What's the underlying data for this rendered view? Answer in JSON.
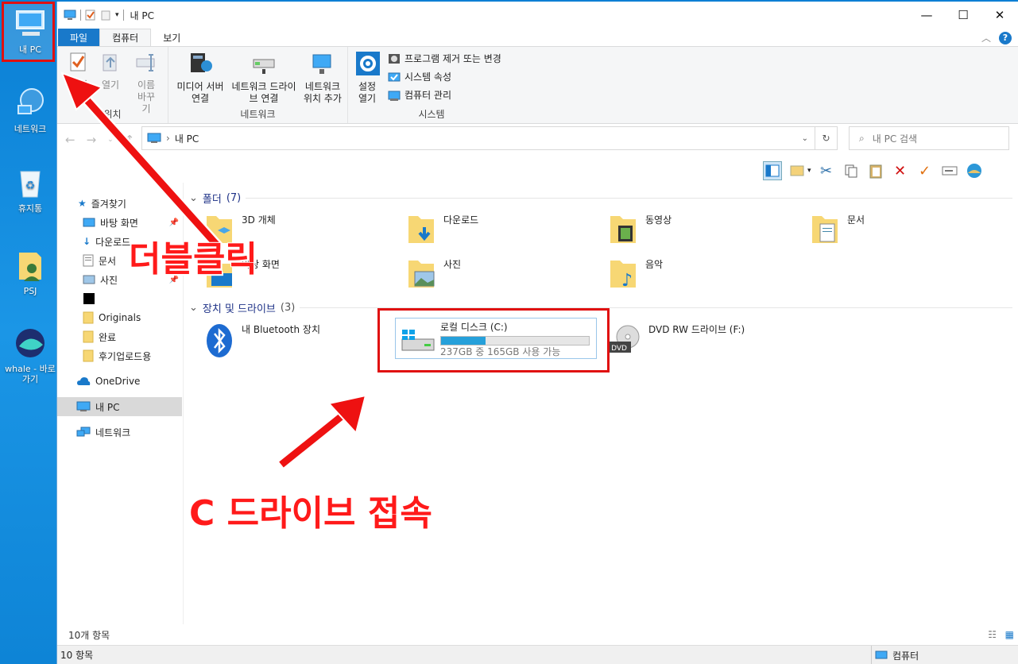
{
  "desktop": {
    "icons": [
      {
        "label": "내 PC"
      },
      {
        "label": "네트워크"
      },
      {
        "label": "휴지통"
      },
      {
        "label": "PSJ"
      },
      {
        "label": "whale - 바로 가기"
      }
    ]
  },
  "window": {
    "title": "내 PC",
    "tabs": [
      "파일",
      "컴퓨터",
      "보기"
    ],
    "ribbon": {
      "location_group": "위치",
      "props_label": "속성",
      "open_label": "열기",
      "rename_label": "이름 바꾸기",
      "media_label": "미디어 서버 연결",
      "netdrive_label": "네트워크 드라이브 연결",
      "netloc_label": "네트워크 위치 추가",
      "network_group": "네트워크",
      "settings_label": "설정 열기",
      "uninstall_label": "프로그램 제거 또는 변경",
      "sysprops_label": "시스템 속성",
      "manage_label": "컴퓨터 관리",
      "system_group": "시스템"
    },
    "address": "내 PC",
    "search_placeholder": "내 PC 검색",
    "nav": {
      "quick": "즐겨찾기",
      "items": [
        "바탕 화면",
        "다운로드",
        "문서",
        "사진",
        "",
        "Originals",
        "완료",
        "후기업로드용"
      ],
      "onedrive": "OneDrive",
      "thispc": "내 PC",
      "network": "네트워크"
    },
    "folders_header": "폴더",
    "folders_count": "(7)",
    "folders": [
      "3D 개체",
      "다운로드",
      "동영상",
      "문서",
      "바탕 화면",
      "사진",
      "음악"
    ],
    "devices_header": "장치 및 드라이브",
    "devices_count": "(3)",
    "bluetooth": "내 Bluetooth 장치",
    "local_disk": {
      "name": "로컬 디스크 (C:)",
      "free": "237GB 중 165GB 사용 가능",
      "used_fraction": 0.3
    },
    "dvd": "DVD RW 드라이브 (F:)",
    "status_count": "10개 항목",
    "statusbar_left": "10 항목",
    "statusbar_right": "컴퓨터"
  },
  "annotations": {
    "double_click": "더블클릭",
    "connect_c": "C 드라이브 접속"
  },
  "colors": {
    "accent": "#1979ca",
    "annotation_red": "#ff1a1a"
  }
}
